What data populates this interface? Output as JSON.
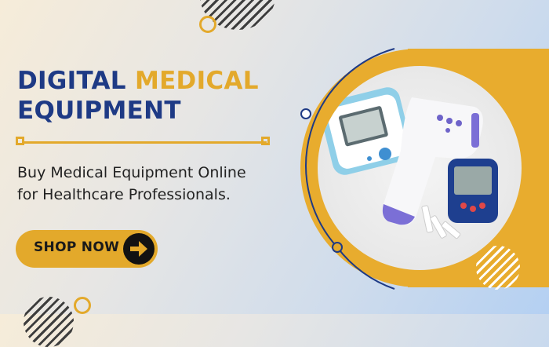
{
  "headline": {
    "line1_part1": "DIGITAL",
    "line1_part2": "MEDICAL",
    "line2": "EQUIPMENT"
  },
  "subtitle": {
    "line1": "Buy Medical Equipment Online",
    "line2": "for Healthcare Professionals."
  },
  "cta": {
    "label": "SHOP NOW",
    "icon": "arrow-right-icon"
  },
  "colors": {
    "navy": "#1e3a85",
    "gold": "#e3a92b",
    "text": "#222222"
  },
  "image": {
    "subject": "medical-devices-photo"
  }
}
